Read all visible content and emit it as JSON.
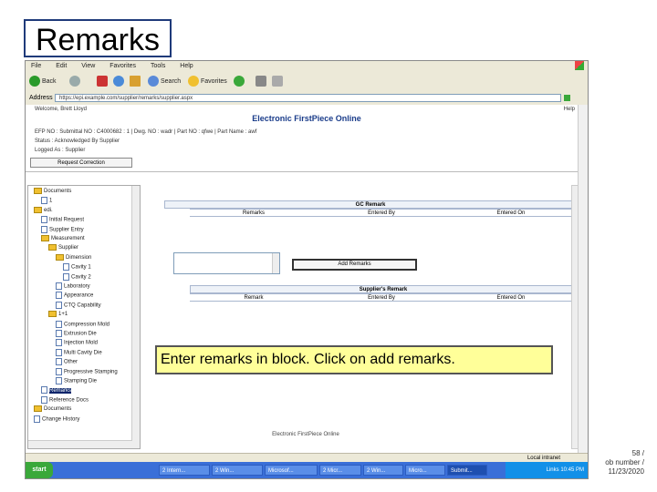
{
  "slide": {
    "title": "Remarks",
    "callout": "Enter remarks in block. Click on add remarks.",
    "footer_lines": [
      "58 /",
      "ob number /",
      "11/23/2020"
    ]
  },
  "browser": {
    "menu": [
      "File",
      "Edit",
      "View",
      "Favorites",
      "Tools",
      "Help"
    ],
    "toolbar": {
      "back": "Back",
      "search": "Search",
      "favorites": "Favorites"
    },
    "address_label": "Address",
    "address_value": "https://epi.example.com/supplier/remarks/supplier.aspx",
    "status_text": "Local intranet"
  },
  "app": {
    "welcome": "Welcome, Brett Lloyd",
    "title": "Electronic FirstPiece Online",
    "help": "Help",
    "info": "EFP NO : Submittal NO : C4000682 : 1  |  Dwg. NO : wadr  |  Part NO : qfwe  |  Part Name : awf",
    "status": "Status : Acknowledged By Supplier",
    "logged_as": "Logged As : Supplier",
    "request_btn": "Request Correction",
    "gc_section": {
      "title": "GC Remark",
      "columns": [
        "Remarks",
        "Entered By",
        "Entered On"
      ]
    },
    "supplier_section": {
      "title": "Supplier's Remark",
      "columns": [
        "Remark",
        "Entered By",
        "Entered On"
      ]
    },
    "add_remarks_btn": "Add Remarks",
    "footer": "Electronic FirstPiece Online"
  },
  "tree": [
    "Documents",
    "1",
    "edi.",
    "Initial Request",
    "Supplier Entry",
    "Measurement",
    "Supplier",
    "Dimension",
    "Cavity 1",
    "Cavity 2",
    "Laboratory",
    "Appearance",
    "CTQ Capability",
    "1+1",
    "Compression Mold",
    "Extrusion Die",
    "Injection Mold",
    "Multi Cavity Die",
    "Other",
    "Progressive Stamping",
    "Stamping Die",
    "Remarks",
    "Reference Docs",
    "Documents",
    "Change History"
  ],
  "taskbar": {
    "start": "start",
    "tasks": [
      "2 Intern...",
      "2 Win...",
      "Microsof...",
      "2 Micr...",
      "2 Win...",
      "Micro...",
      "Submit..."
    ],
    "tray": "Links  10:45 PM"
  }
}
